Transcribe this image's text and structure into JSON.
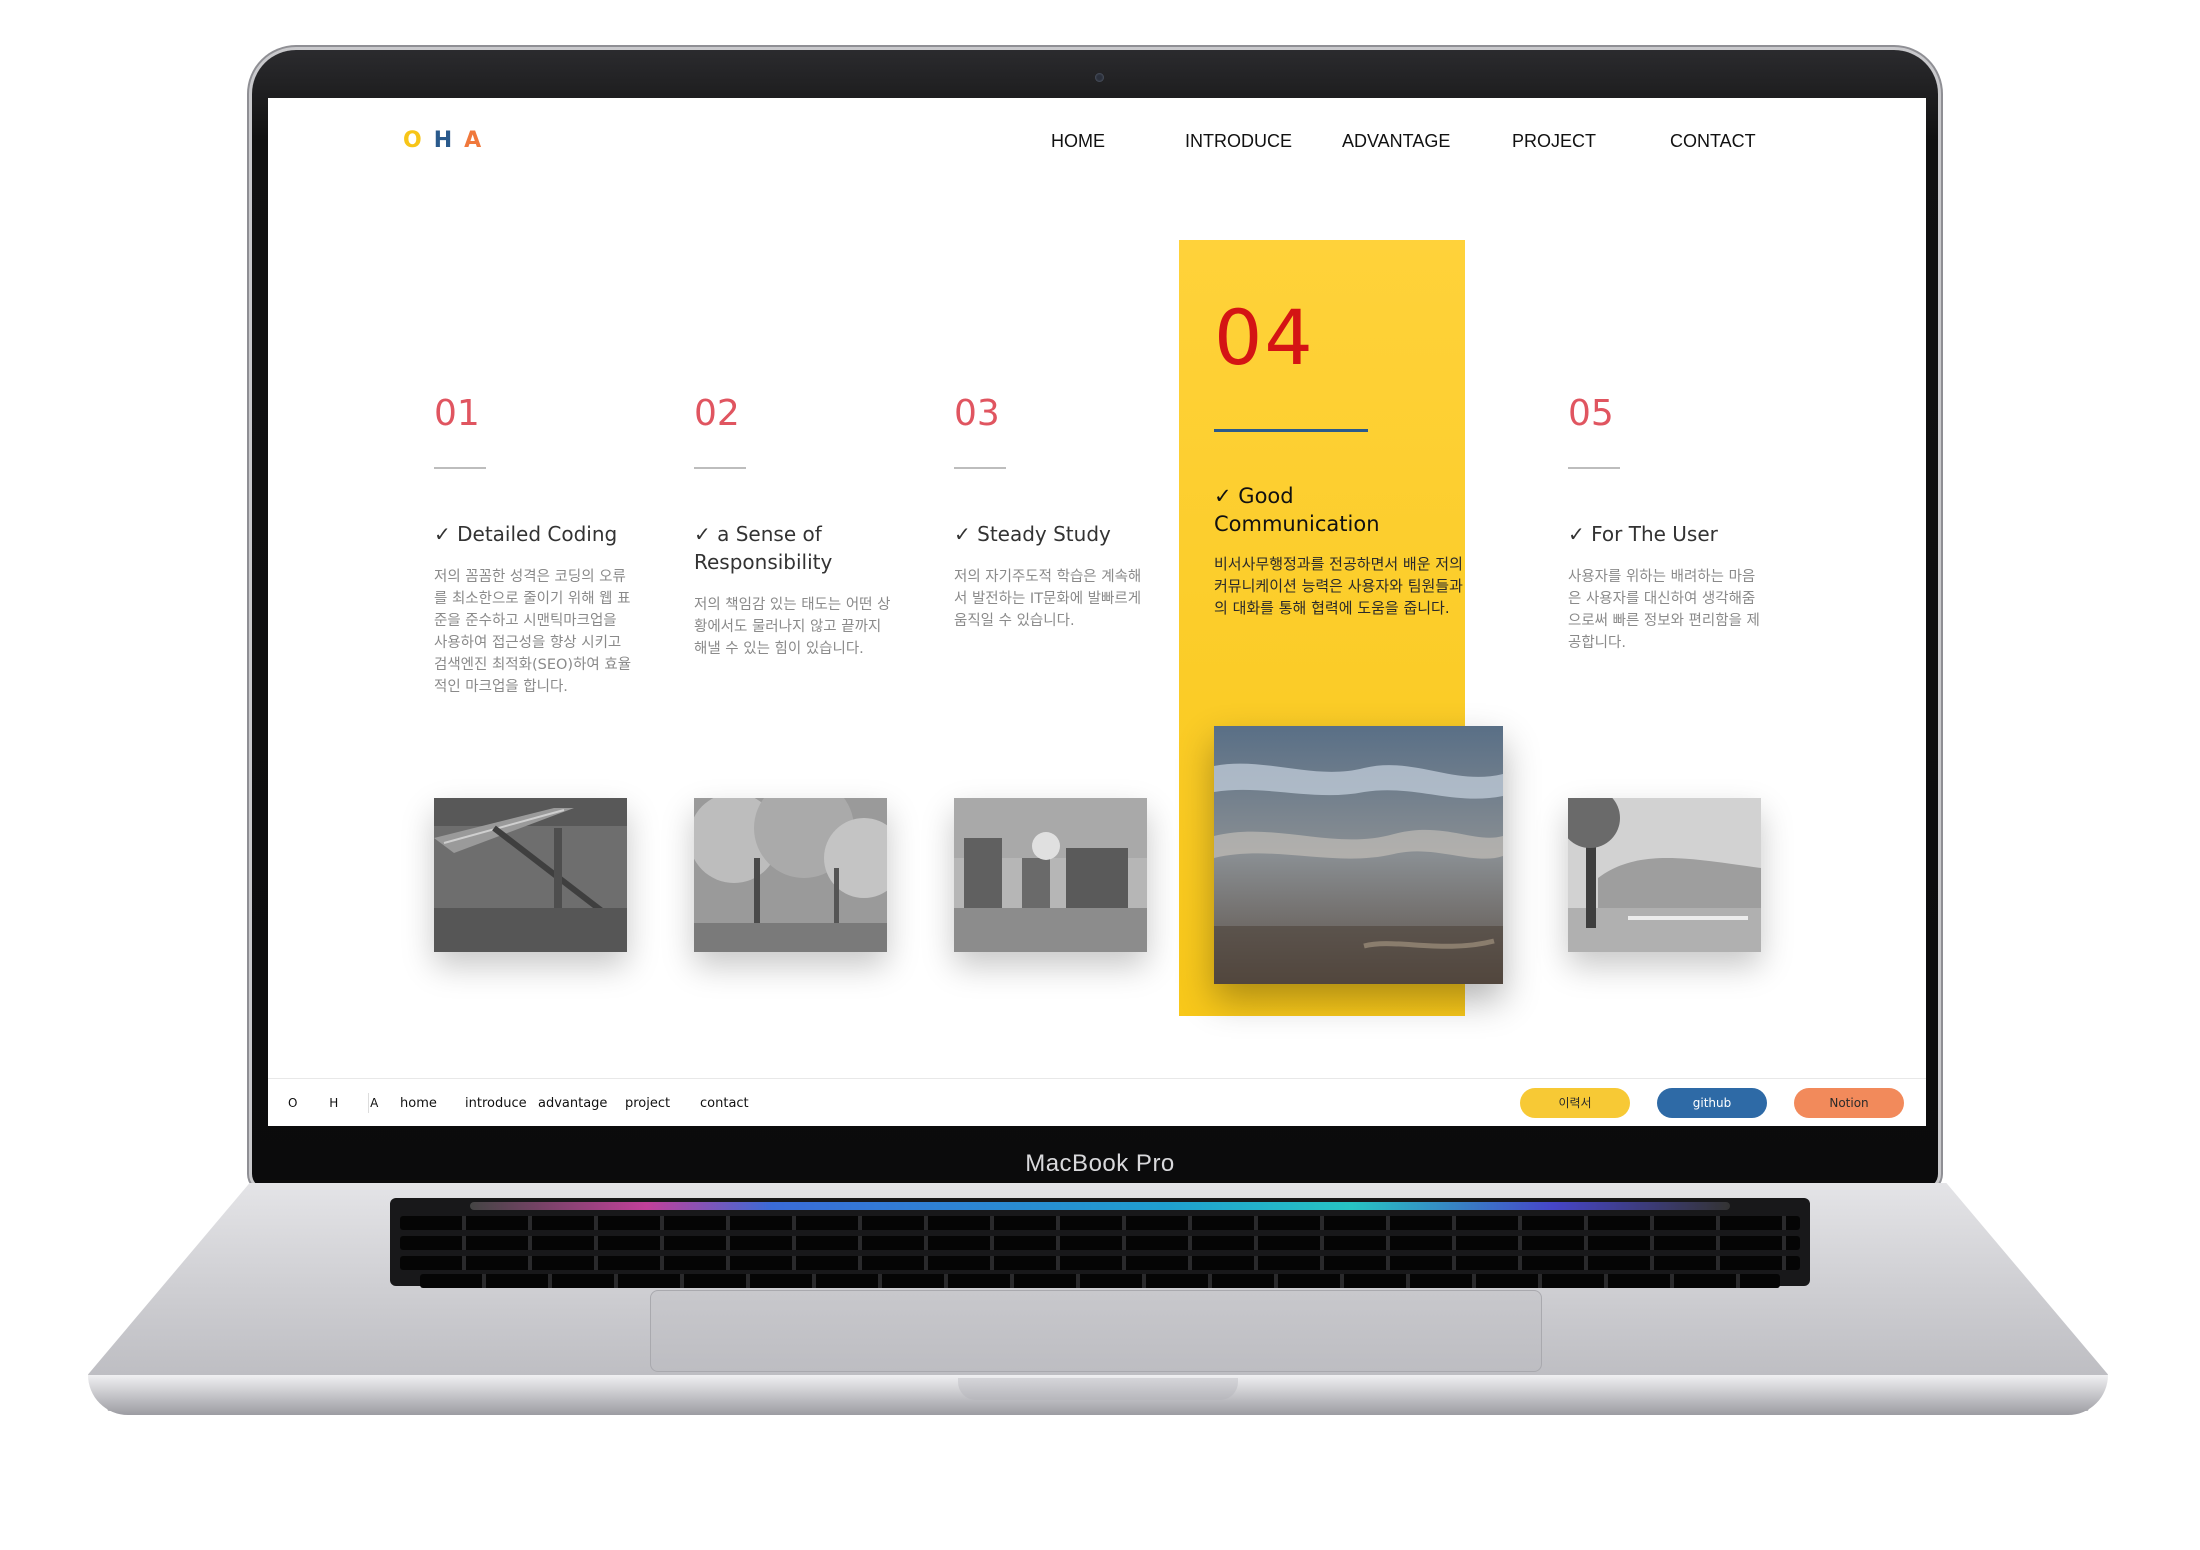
{
  "device": {
    "label": "MacBook Pro"
  },
  "site": {
    "logo": {
      "letters": [
        "O",
        "H",
        "A"
      ],
      "colors": [
        "#F7C518",
        "#2A5A8C",
        "#F0783C"
      ]
    },
    "nav": [
      "HOME",
      "INTRODUCE",
      "ADVANTAGE",
      "PROJECT",
      "CONTACT"
    ],
    "cards": [
      {
        "number": "01",
        "check": "✓",
        "title": "Detailed Coding",
        "desc": "저의 꼼꼼한 성격은 코딩의 오류를 최소한으로 줄이기 위해 웹 표준을 준수하고 시맨틱마크업을 사용하여 접근성을 향상 시키고 검색엔진 최적화(SEO)하여 효율적인 마크업을 합니다.",
        "photo": "stairs-photo"
      },
      {
        "number": "02",
        "check": "✓",
        "title": "a Sense of Responsibility",
        "desc": "저의 책임감 있는 태도는 어떤 상황에서도 물러나지 않고 끝까지 해낼 수 있는 힘이 있습니다.",
        "photo": "trees-photo"
      },
      {
        "number": "03",
        "check": "✓",
        "title": "Steady Study",
        "desc": "저의 자기주도적 학습은 계속해서 발전하는 IT문화에 발빠르게 움직일 수 있습니다.",
        "photo": "city-photo"
      },
      {
        "number": "04",
        "check": "✓",
        "title": "Good Communication",
        "desc": "비서사무행정과를 전공하면서 배운 저의 커뮤니케이션 능력은 사용자와 팀원들과의 대화를 통해 협력에 도움을 줍니다.",
        "photo": "water-photo"
      },
      {
        "number": "05",
        "check": "✓",
        "title": "For The User",
        "desc": "사용자를 위하는 배려하는 마음은 사용자를 대신하여 생각해줌으로써 빠른 정보와 편리함을 제공합니다.",
        "photo": "landscape-photo"
      }
    ],
    "footer": {
      "logo": "O H A",
      "links": [
        "home",
        "introduce",
        "advantage",
        "project",
        "contact"
      ],
      "buttons": [
        {
          "label": "이력서",
          "color": "#F7C935"
        },
        {
          "label": "github",
          "color": "#2E6AA6"
        },
        {
          "label": "Notion",
          "color": "#F28A5B"
        }
      ]
    }
  }
}
